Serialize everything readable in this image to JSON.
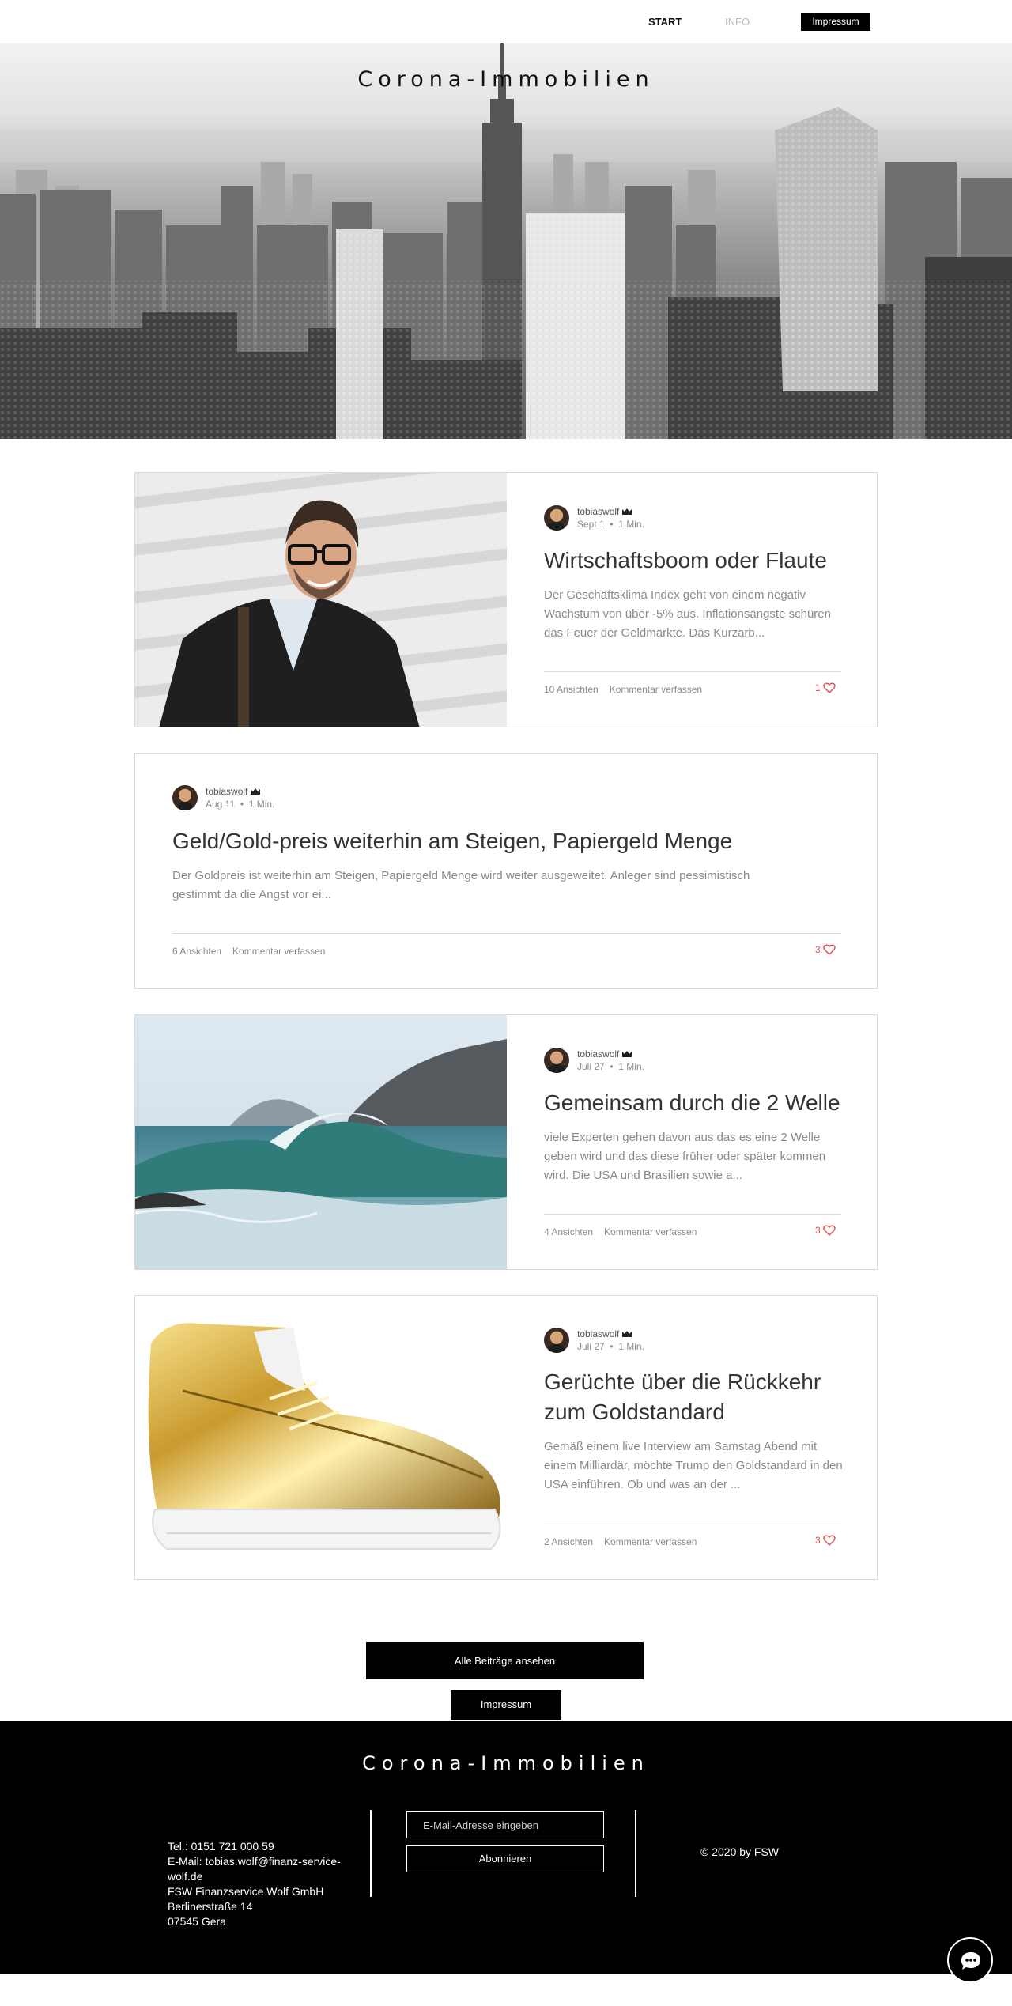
{
  "nav": {
    "start": "START",
    "info": "INFO",
    "impressum": "Impressum"
  },
  "hero": {
    "title": "Corona-Immobilien"
  },
  "posts": [
    {
      "author": "tobiaswolf",
      "date": "Sept 1",
      "read_time": "1 Min.",
      "title": "Wirtschaftsboom oder Flaute",
      "excerpt": "Der Geschäftsklima Index geht von einem negativ Wachstum von über -5% aus. Inflationsängste schüren das Feuer der Geldmärkte. Das Kurzarb...",
      "views": "10 Ansichten",
      "comment": "Kommentar verfassen",
      "likes": "1",
      "image": "portrait-man"
    },
    {
      "author": "tobiaswolf",
      "date": "Aug 11",
      "read_time": "1 Min.",
      "title": "Geld/Gold-preis weiterhin am Steigen, Papiergeld Menge",
      "excerpt": "Der Goldpreis ist weiterhin am Steigen, Papiergeld Menge wird weiter ausgeweitet. Anleger sind pessimistisch gestimmt da die Angst vor ei...",
      "views": "6 Ansichten",
      "comment": "Kommentar verfassen",
      "likes": "3"
    },
    {
      "author": "tobiaswolf",
      "date": "Juli 27",
      "read_time": "1 Min.",
      "title": "Gemeinsam durch die 2 Welle",
      "excerpt": "viele Experten gehen davon aus das es eine 2 Welle geben wird und das diese früher oder später kommen wird. Die USA und Brasilien sowie a...",
      "views": "4 Ansichten",
      "comment": "Kommentar verfassen",
      "likes": "3",
      "image": "ocean-wave"
    },
    {
      "author": "tobiaswolf",
      "date": "Juli 27",
      "read_time": "1 Min.",
      "title_line1": "Gerüchte über die Rückkehr",
      "title_line2": "zum Goldstandard",
      "excerpt": "Gemäß einem live Interview am Samstag Abend mit einem Milliardär, möchte Trump den Goldstandard in den USA einführen. Ob und was an der ...",
      "views": "2 Ansichten",
      "comment": "Kommentar verfassen",
      "likes": "3",
      "image": "gold-sneaker"
    }
  ],
  "buttons": {
    "all_posts": "Alle Beiträge ansehen",
    "impressum": "Impressum"
  },
  "footer": {
    "title": "Corona-Immobilien",
    "contact": {
      "phone": "Tel.: 0151 721 000 59",
      "email_line1": "E-Mail: tobias.wolf@finanz-service-",
      "email_line2": "wolf.de",
      "company": "FSW Finanzservice Wolf GmbH",
      "street": "Berlinerstraße 14",
      "city": "07545 Gera"
    },
    "newsletter": {
      "placeholder": "E-Mail-Adresse eingeben",
      "subscribe": "Abonnieren"
    },
    "copyright": "© 2020 by FSW"
  },
  "colors": {
    "accent": "#000000",
    "like": "#e24c4c",
    "muted_text": "#8a8a8a",
    "border": "#d9d9d9"
  },
  "icons": [
    "crown-icon",
    "heart-icon",
    "chat-icon"
  ]
}
